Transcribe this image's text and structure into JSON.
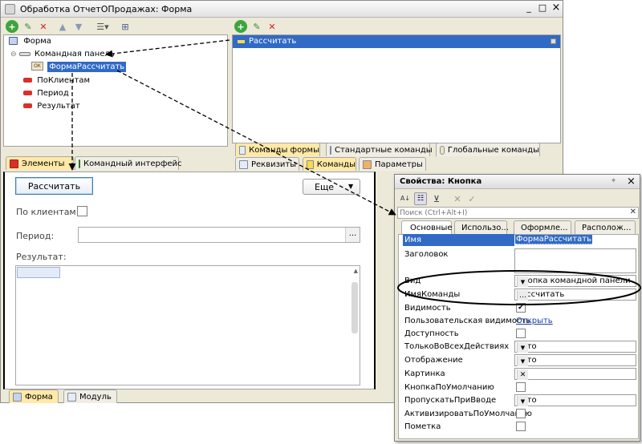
{
  "main_window": {
    "title": "Обработка ОтчетОПродажах: Форма",
    "controls": [
      "_",
      "□",
      "×"
    ]
  },
  "elements_tree": {
    "items": [
      {
        "label": "Форма",
        "level": 0,
        "icon": "form-icon"
      },
      {
        "label": "Командная панель",
        "level": 1,
        "icon": "command-panel-icon"
      },
      {
        "label": "ФормаРассчитать",
        "level": 2,
        "icon": "button-ok-icon",
        "selected": true
      },
      {
        "label": "ПоКлиентам",
        "level": 1,
        "icon": "field-icon"
      },
      {
        "label": "Период",
        "level": 1,
        "icon": "field-icon"
      },
      {
        "label": "Результат",
        "level": 1,
        "icon": "field-icon"
      }
    ],
    "tabs": [
      "Элементы",
      "Командный интерфейс"
    ]
  },
  "commands_list": {
    "items": [
      {
        "label": "Рассчитать",
        "selected": true
      }
    ],
    "tabs_row1": [
      "Команды формы",
      "Стандартные команды",
      "Глобальные команды"
    ],
    "tabs_row2": [
      "Реквизиты",
      "Команды",
      "Параметры"
    ]
  },
  "form_preview": {
    "calc_button": "Рассчитать",
    "more_button": "Еще",
    "by_clients_label": "По клиентам:",
    "period_label": "Период:",
    "period_button": "...",
    "result_label": "Результат:",
    "bottom_tabs": [
      "Форма",
      "Модуль"
    ]
  },
  "properties": {
    "title": "Свойства: Кнопка",
    "controls": [
      "×"
    ],
    "search_placeholder": "Поиск (Ctrl+Alt+I)",
    "tabs": [
      "Основные",
      "Использо...",
      "Оформле...",
      "Располож..."
    ],
    "rows": [
      {
        "label": "Имя",
        "value": "ФормаРассчитать",
        "kind": "text-selected"
      },
      {
        "label": "Заголовок",
        "value": "",
        "kind": "textarea"
      },
      {
        "label": "Вид",
        "value": "Кнопка командной панели",
        "kind": "select"
      },
      {
        "label": "ИмяКоманды",
        "value": "Рассчитать",
        "kind": "choice"
      },
      {
        "label": "Видимость",
        "value": "✔",
        "kind": "checkbox-checked"
      },
      {
        "label": "Пользовательская видимость",
        "value": "Открыть",
        "kind": "link"
      },
      {
        "label": "Доступность",
        "value": "",
        "kind": "checkbox"
      },
      {
        "label": "ТолькоВоВсехДействиях",
        "value": "Авто",
        "kind": "select"
      },
      {
        "label": "Отображение",
        "value": "Авто",
        "kind": "select"
      },
      {
        "label": "Картинка",
        "value": "",
        "kind": "choice-clear"
      },
      {
        "label": "КнопкаПоУмолчанию",
        "value": "",
        "kind": "checkbox"
      },
      {
        "label": "ПропускатьПриВводе",
        "value": "Авто",
        "kind": "select"
      },
      {
        "label": "АктивизироватьПоУмолчанию",
        "value": "",
        "kind": "checkbox"
      },
      {
        "label": "Пометка",
        "value": "",
        "kind": "checkbox"
      }
    ]
  },
  "colors": {
    "selection": "#316ac5",
    "active_tab": "#ffe9a6",
    "window_frame": "#d4d0c8",
    "annotation_ellipse": "#000000"
  }
}
